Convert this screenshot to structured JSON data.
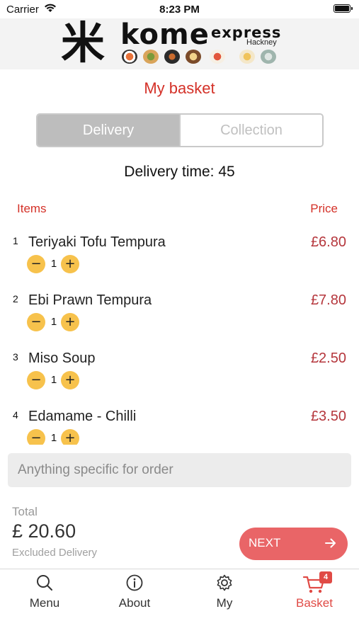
{
  "status_bar": {
    "carrier": "Carrier",
    "time": "8:23 PM"
  },
  "header": {
    "logo_kanji": "米",
    "logo_main": "kome",
    "logo_express": "express",
    "logo_location": "Hackney"
  },
  "page_title": "My basket",
  "order_type": {
    "options": [
      "Delivery",
      "Collection"
    ],
    "selected": "Delivery"
  },
  "delivery_time": "Delivery time: 45",
  "columns": {
    "items": "Items",
    "price": "Price"
  },
  "items": [
    {
      "index": "1",
      "name": "Teriyaki Tofu Tempura",
      "quantity": "1",
      "price": "£6.80"
    },
    {
      "index": "2",
      "name": "Ebi Prawn Tempura",
      "quantity": "1",
      "price": "£7.80"
    },
    {
      "index": "3",
      "name": "Miso Soup",
      "quantity": "1",
      "price": "£2.50"
    },
    {
      "index": "4",
      "name": "Edamame - Chilli",
      "quantity": "1",
      "price": "£3.50"
    }
  ],
  "order_note": {
    "placeholder": "Anything specific for order",
    "value": ""
  },
  "summary": {
    "total_label": "Total",
    "total_amount": "£ 20.60",
    "note": "Excluded Delivery"
  },
  "next_button": {
    "label": "NEXT",
    "color": "#e96567"
  },
  "tab_bar": {
    "items": [
      {
        "label": "Menu",
        "icon": "search-icon"
      },
      {
        "label": "About",
        "icon": "info-icon"
      },
      {
        "label": "My",
        "icon": "gear-icon"
      },
      {
        "label": "Basket",
        "icon": "cart-icon",
        "badge": "4",
        "active": true
      }
    ]
  },
  "colors": {
    "accent_red": "#d43128",
    "stepper_yellow": "#f7c24c",
    "price_red": "#b5363c"
  }
}
